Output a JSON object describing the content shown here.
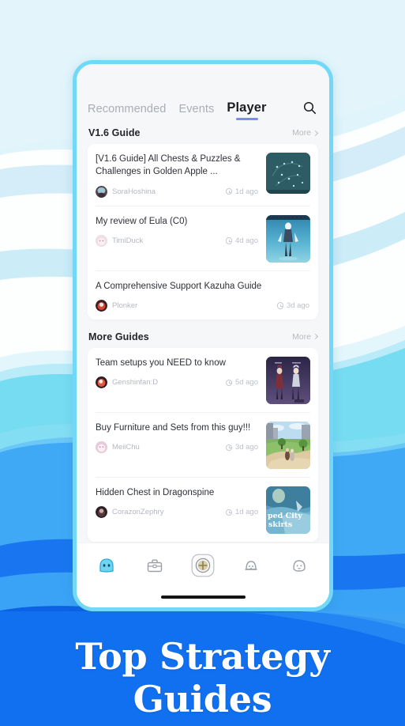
{
  "background": {
    "base_color": "#dff4fb",
    "wave_colors": [
      "#ffffff",
      "#c8eaf6",
      "#76dcf2",
      "#3fa9f5",
      "#1976f0",
      "#0b5fe0"
    ]
  },
  "phone": {
    "frame_color": "#72d8f7",
    "screen_bg": "#f6f7f9"
  },
  "tabs": [
    {
      "label": "Recommended",
      "active": false,
      "name": "tab-recommended"
    },
    {
      "label": "Events",
      "active": false,
      "name": "tab-events"
    },
    {
      "label": "Player",
      "active": true,
      "name": "tab-player"
    }
  ],
  "tab_accent_color": "#7b8cf0",
  "search": {
    "icon": "search-icon",
    "label": "Search"
  },
  "sections": [
    {
      "title": "V1.6 Guide",
      "more_label": "More",
      "more_icon": "chevron-right-icon",
      "posts": [
        {
          "title": "[V1.6 Guide] All Chests & Puzzles & Challenges in Golden Apple ...",
          "author": "SoraHoshina",
          "time": "1d ago",
          "thumb": "map-golden-apple",
          "thumb_color": "#2d5b63"
        },
        {
          "title": "My review of Eula (C0)",
          "author": "TimiDuck",
          "time": "4d ago",
          "thumb": "character-eula",
          "thumb_color": "#3d9cc4"
        },
        {
          "title": "A Comprehensive Support Kazuha Guide",
          "author": "Plonker",
          "time": "3d ago",
          "thumb": "none",
          "thumb_color": ""
        }
      ]
    },
    {
      "title": "More Guides",
      "more_label": "More",
      "more_icon": "chevron-right-icon",
      "posts": [
        {
          "title": "Team setups you NEED to know",
          "author": "Genshinfan:D",
          "time": "5d ago",
          "thumb": "team-setup-characters",
          "thumb_color": "#3a3359"
        },
        {
          "title": "Buy Furniture and Sets from this guy!!!",
          "author": "MeiiChu",
          "time": "3d ago",
          "thumb": "serenitea-pot-scene",
          "thumb_color": "#8fb67b"
        },
        {
          "title": "Hidden Chest in Dragonspine",
          "author": "CorazonZephry",
          "time": "1d ago",
          "thumb": "dragonspine-map",
          "thumb_color": "#5fa7c4",
          "thumb_overlay_text_1": "ped City",
          "thumb_overlay_text_2": "skirts"
        }
      ]
    }
  ],
  "bottom_nav": [
    {
      "name": "nav-home-slime",
      "icon": "slime-icon",
      "active": true
    },
    {
      "name": "nav-toolbox",
      "icon": "toolbox-icon",
      "active": false
    },
    {
      "name": "nav-create",
      "icon": "compass-plus-icon",
      "active": false
    },
    {
      "name": "nav-notifications",
      "icon": "bell-icon",
      "active": false
    },
    {
      "name": "nav-profile",
      "icon": "ghost-icon",
      "active": false
    }
  ],
  "home_indicator": {
    "visible": true,
    "color": "#131313"
  },
  "banner": {
    "headline": "Top Strategy Guides",
    "bg_color": "#1170ef",
    "text_color": "#ffffff"
  }
}
